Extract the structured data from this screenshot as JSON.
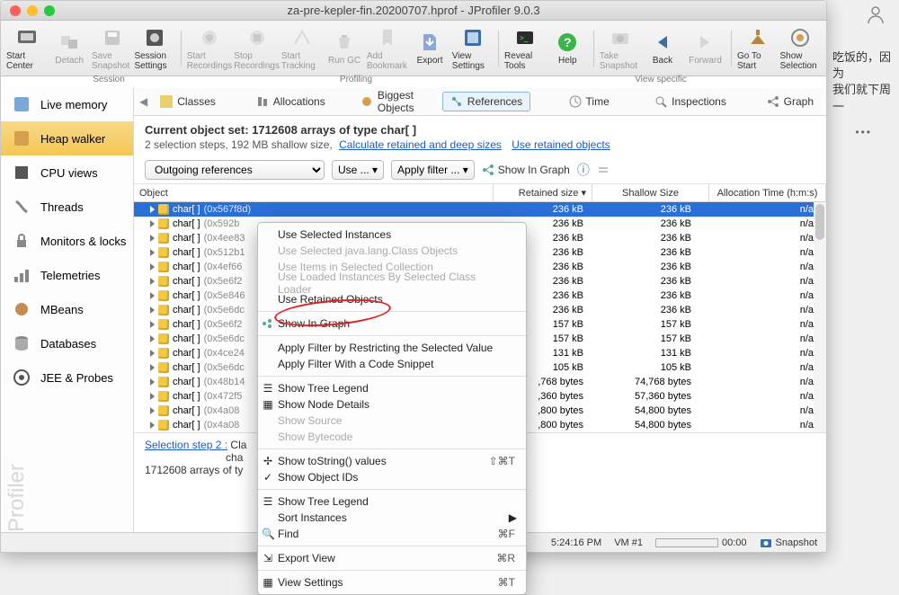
{
  "window": {
    "title": "za-pre-kepler-fin.20200707.hprof - JProfiler 9.0.3"
  },
  "toolbar": {
    "start_center": "Start Center",
    "detach": "Detach",
    "save_snapshot": "Save Snapshot",
    "session_settings": "Session Settings",
    "start_recordings": "Start Recordings",
    "stop_recordings": "Stop Recordings",
    "start_tracking": "Start Tracking",
    "run_gc": "Run GC",
    "add_bookmark": "Add Bookmark",
    "export": "Export",
    "view_settings": "View Settings",
    "reveal_tools": "Reveal Tools",
    "help": "Help",
    "take_snapshot": "Take Snapshot",
    "back": "Back",
    "forward": "Forward",
    "go_to_start": "Go To Start",
    "show_selection": "Show Selection"
  },
  "toolbar_groups": {
    "session": "Session",
    "profiling": "Profiling",
    "view_specific": "View specific"
  },
  "sidebar": {
    "items": [
      {
        "label": "Live memory"
      },
      {
        "label": "Heap walker"
      },
      {
        "label": "CPU views"
      },
      {
        "label": "Threads"
      },
      {
        "label": "Monitors & locks"
      },
      {
        "label": "Telemetries"
      },
      {
        "label": "MBeans"
      },
      {
        "label": "Databases"
      },
      {
        "label": "JEE & Probes"
      }
    ],
    "brand": "JProfiler"
  },
  "subtabs": {
    "caret_left": "◀",
    "items": [
      {
        "label": "Classes"
      },
      {
        "label": "Allocations"
      },
      {
        "label": "Biggest Objects"
      },
      {
        "label": "References"
      },
      {
        "label": "Time"
      },
      {
        "label": "Inspections"
      },
      {
        "label": "Graph"
      }
    ]
  },
  "header": {
    "title_prefix": "Current object set:",
    "title_rest": "1712608 arrays of type char[ ]",
    "sub": "2 selection steps, 192 MB shallow size,",
    "link1": "Calculate retained and deep sizes",
    "link2": "Use retained objects"
  },
  "controls": {
    "refs": "Outgoing references",
    "use": "Use ... ▾",
    "apply": "Apply filter ... ▾",
    "show_graph": "Show In Graph",
    "info": "ⓘ"
  },
  "columns": {
    "object": "Object",
    "retained": "Retained size ▾",
    "shallow": "Shallow Size",
    "alloc": "Allocation Time (h:m:s)"
  },
  "rows": [
    {
      "label": "char[ ]",
      "addr": "(0x567f8d)",
      "ret": "236 kB",
      "shal": "236 kB",
      "alloc": "n/a"
    },
    {
      "label": "char[ ]",
      "addr": "(0x592b",
      "ret": "236 kB",
      "shal": "236 kB",
      "alloc": "n/a"
    },
    {
      "label": "char[ ]",
      "addr": "(0x4ee83",
      "ret": "236 kB",
      "shal": "236 kB",
      "alloc": "n/a"
    },
    {
      "label": "char[ ]",
      "addr": "(0x512b1",
      "ret": "236 kB",
      "shal": "236 kB",
      "alloc": "n/a"
    },
    {
      "label": "char[ ]",
      "addr": "(0x4ef66",
      "ret": "236 kB",
      "shal": "236 kB",
      "alloc": "n/a"
    },
    {
      "label": "char[ ]",
      "addr": "(0x5e6f2",
      "ret": "236 kB",
      "shal": "236 kB",
      "alloc": "n/a"
    },
    {
      "label": "char[ ]",
      "addr": "(0x5e846",
      "ret": "236 kB",
      "shal": "236 kB",
      "alloc": "n/a"
    },
    {
      "label": "char[ ]",
      "addr": "(0x5e6dc",
      "ret": "236 kB",
      "shal": "236 kB",
      "alloc": "n/a"
    },
    {
      "label": "char[ ]",
      "addr": "(0x5e6f2",
      "ret": "157 kB",
      "shal": "157 kB",
      "alloc": "n/a"
    },
    {
      "label": "char[ ]",
      "addr": "(0x5e6dc",
      "ret": "157 kB",
      "shal": "157 kB",
      "alloc": "n/a"
    },
    {
      "label": "char[ ]",
      "addr": "(0x4ce24",
      "ret": "131 kB",
      "shal": "131 kB",
      "alloc": "n/a"
    },
    {
      "label": "char[ ]",
      "addr": "(0x5e6dc",
      "ret": "105 kB",
      "shal": "105 kB",
      "alloc": "n/a"
    },
    {
      "label": "char[ ]",
      "addr": "(0x48b14",
      "ret": ",768 bytes",
      "shal": "74,768 bytes",
      "alloc": "n/a"
    },
    {
      "label": "char[ ]",
      "addr": "(0x472f5",
      "ret": ",360 bytes",
      "shal": "57,360 bytes",
      "alloc": "n/a"
    },
    {
      "label": "char[ ]",
      "addr": "(0x4a08",
      "ret": ",800 bytes",
      "shal": "54,800 bytes",
      "alloc": "n/a"
    },
    {
      "label": "char[ ]",
      "addr": "(0x4a08",
      "ret": ",800 bytes",
      "shal": "54,800 bytes",
      "alloc": "n/a"
    }
  ],
  "selstep": {
    "lbl": "Selection step 2 :",
    "cont1": "Cla",
    "cont2": "cha",
    "summary": "1712608 arrays of ty"
  },
  "ctx": {
    "use_sel_instances": "Use Selected Instances",
    "use_sel_class": "Use Selected java.lang.Class Objects",
    "use_items": "Use Items in Selected Collection",
    "use_loaded": "Use Loaded Instances By Selected Class Loader",
    "use_retained": "Use Retained Objects",
    "show_in_graph": "Show In Graph",
    "apply_restrict": "Apply Filter by Restricting the Selected Value",
    "apply_snippet": "Apply Filter With a Code Snippet",
    "show_tree_legend": "Show Tree Legend",
    "show_node_details": "Show Node Details",
    "show_source": "Show Source",
    "show_bytecode": "Show Bytecode",
    "show_tostring": "Show toString() values",
    "kb_tostring": "⇧⌘T",
    "show_obj_ids": "Show Object IDs",
    "check": "✓",
    "show_tree_legend2": "Show Tree Legend",
    "sort_instances": "Sort Instances",
    "caret": "▶",
    "find": "Find",
    "kb_find": "⌘F",
    "export_view": "Export View",
    "kb_export": "⌘R",
    "view_settings": "View Settings",
    "kb_vs": "⌘T"
  },
  "status": {
    "time": "5:24:16 PM",
    "vm": "VM #1",
    "progress": "00:00",
    "snapshot": "Snapshot"
  },
  "ext": {
    "line1": "吃饭的，因为",
    "line2": "我们就下周一"
  }
}
